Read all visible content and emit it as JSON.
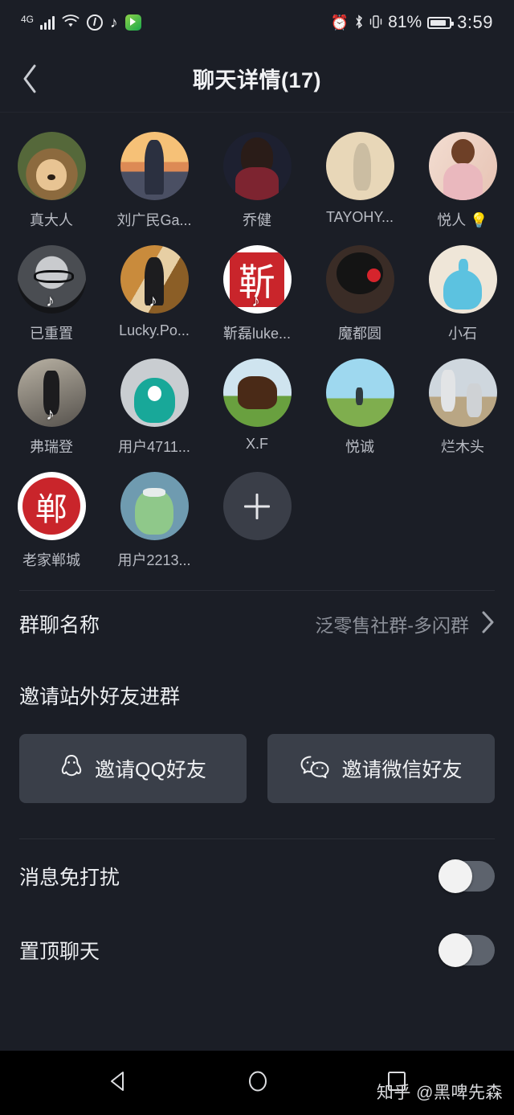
{
  "status_bar": {
    "network": "4G",
    "battery_percent": "81%",
    "time": "3:59",
    "left_icons": [
      "signal-bars-icon",
      "wifi-icon",
      "netease-music-icon",
      "tiktok-icon",
      "video-app-icon"
    ],
    "right_icons": [
      "alarm-clock-icon",
      "bluetooth-icon",
      "vibrate-icon",
      "battery-icon"
    ]
  },
  "header": {
    "back_icon": "chevron-left-icon",
    "title": "聊天详情(17)"
  },
  "members": [
    {
      "name": "真大人",
      "art": "av-dog",
      "badge": ""
    },
    {
      "name": "刘广民Ga...",
      "art": "av-sunset",
      "badge": ""
    },
    {
      "name": "乔健",
      "art": "av-girl",
      "badge": ""
    },
    {
      "name": "TAYOHY...",
      "art": "av-hanfu",
      "badge": ""
    },
    {
      "name": "悦人 💡",
      "art": "av-lady",
      "badge": ""
    },
    {
      "name": "已重置",
      "art": "av-bw",
      "badge": "♪"
    },
    {
      "name": "Lucky.Po...",
      "art": "av-stage",
      "badge": "♪"
    },
    {
      "name": "靳磊luke...",
      "art": "av-seal",
      "badge": "♪"
    },
    {
      "name": "魔都圆",
      "art": "av-kuma",
      "badge": ""
    },
    {
      "name": "小石",
      "art": "av-blob",
      "badge": ""
    },
    {
      "name": "弗瑞登",
      "art": "av-street",
      "badge": "♪"
    },
    {
      "name": "用户4711...",
      "art": "av-monster",
      "badge": ""
    },
    {
      "name": "X.F",
      "art": "av-horse",
      "badge": ""
    },
    {
      "name": "悦诚",
      "art": "av-field",
      "badge": ""
    },
    {
      "name": "烂木头",
      "art": "av-beach",
      "badge": ""
    },
    {
      "name": "老家郸城",
      "art": "av-seal2",
      "badge": ""
    },
    {
      "name": "用户2213...",
      "art": "av-frog",
      "badge": ""
    }
  ],
  "add_member": {
    "icon": "plus-icon"
  },
  "group_name_row": {
    "label": "群聊名称",
    "value": "泛零售社群-多闪群",
    "chevron": "chevron-right-icon"
  },
  "invite": {
    "title": "邀请站外好友进群",
    "qq_button": {
      "label": "邀请QQ好友",
      "icon": "qq-penguin-icon"
    },
    "wechat_button": {
      "label": "邀请微信好友",
      "icon": "wechat-icon"
    }
  },
  "settings": [
    {
      "label": "消息免打扰",
      "enabled": false
    },
    {
      "label": "置顶聊天",
      "enabled": false
    }
  ],
  "nav_bar": {
    "back": "triangle-back-icon",
    "home": "circle-home-icon",
    "recents": "square-recents-icon"
  },
  "watermark": "知乎 @黑啤先森",
  "colors": {
    "background": "#1b1e26",
    "button": "#3a3f49",
    "toggle_track": "#5d636d",
    "muted_text": "#8c9099"
  }
}
